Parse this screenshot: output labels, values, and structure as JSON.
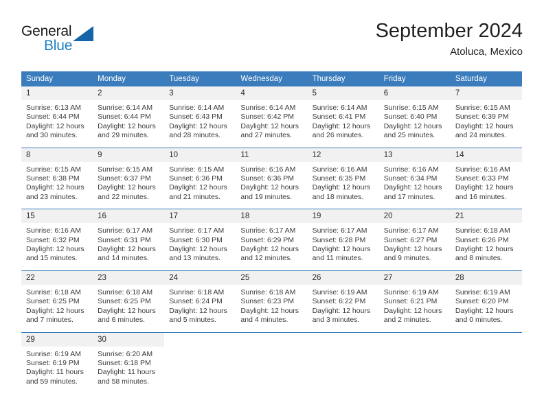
{
  "brand": {
    "name_part1": "General",
    "name_part2": "Blue",
    "logo_icon": "triangle-logo-icon",
    "accent_color": "#1c7fc4",
    "triangle_color": "#1565a8"
  },
  "header": {
    "title": "September 2024",
    "subtitle": "Atoluca, Mexico"
  },
  "theme": {
    "header_blue": "#3b7cbd",
    "daynum_bg": "#f1f1f1",
    "text": "#2b2b2b"
  },
  "calendar": {
    "weekday_headers": [
      "Sunday",
      "Monday",
      "Tuesday",
      "Wednesday",
      "Thursday",
      "Friday",
      "Saturday"
    ],
    "weeks": [
      [
        {
          "day": "1",
          "sunrise": "Sunrise: 6:13 AM",
          "sunset": "Sunset: 6:44 PM",
          "daylight_line1": "Daylight: 12 hours",
          "daylight_line2": "and 30 minutes."
        },
        {
          "day": "2",
          "sunrise": "Sunrise: 6:14 AM",
          "sunset": "Sunset: 6:44 PM",
          "daylight_line1": "Daylight: 12 hours",
          "daylight_line2": "and 29 minutes."
        },
        {
          "day": "3",
          "sunrise": "Sunrise: 6:14 AM",
          "sunset": "Sunset: 6:43 PM",
          "daylight_line1": "Daylight: 12 hours",
          "daylight_line2": "and 28 minutes."
        },
        {
          "day": "4",
          "sunrise": "Sunrise: 6:14 AM",
          "sunset": "Sunset: 6:42 PM",
          "daylight_line1": "Daylight: 12 hours",
          "daylight_line2": "and 27 minutes."
        },
        {
          "day": "5",
          "sunrise": "Sunrise: 6:14 AM",
          "sunset": "Sunset: 6:41 PM",
          "daylight_line1": "Daylight: 12 hours",
          "daylight_line2": "and 26 minutes."
        },
        {
          "day": "6",
          "sunrise": "Sunrise: 6:15 AM",
          "sunset": "Sunset: 6:40 PM",
          "daylight_line1": "Daylight: 12 hours",
          "daylight_line2": "and 25 minutes."
        },
        {
          "day": "7",
          "sunrise": "Sunrise: 6:15 AM",
          "sunset": "Sunset: 6:39 PM",
          "daylight_line1": "Daylight: 12 hours",
          "daylight_line2": "and 24 minutes."
        }
      ],
      [
        {
          "day": "8",
          "sunrise": "Sunrise: 6:15 AM",
          "sunset": "Sunset: 6:38 PM",
          "daylight_line1": "Daylight: 12 hours",
          "daylight_line2": "and 23 minutes."
        },
        {
          "day": "9",
          "sunrise": "Sunrise: 6:15 AM",
          "sunset": "Sunset: 6:37 PM",
          "daylight_line1": "Daylight: 12 hours",
          "daylight_line2": "and 22 minutes."
        },
        {
          "day": "10",
          "sunrise": "Sunrise: 6:15 AM",
          "sunset": "Sunset: 6:36 PM",
          "daylight_line1": "Daylight: 12 hours",
          "daylight_line2": "and 21 minutes."
        },
        {
          "day": "11",
          "sunrise": "Sunrise: 6:16 AM",
          "sunset": "Sunset: 6:36 PM",
          "daylight_line1": "Daylight: 12 hours",
          "daylight_line2": "and 19 minutes."
        },
        {
          "day": "12",
          "sunrise": "Sunrise: 6:16 AM",
          "sunset": "Sunset: 6:35 PM",
          "daylight_line1": "Daylight: 12 hours",
          "daylight_line2": "and 18 minutes."
        },
        {
          "day": "13",
          "sunrise": "Sunrise: 6:16 AM",
          "sunset": "Sunset: 6:34 PM",
          "daylight_line1": "Daylight: 12 hours",
          "daylight_line2": "and 17 minutes."
        },
        {
          "day": "14",
          "sunrise": "Sunrise: 6:16 AM",
          "sunset": "Sunset: 6:33 PM",
          "daylight_line1": "Daylight: 12 hours",
          "daylight_line2": "and 16 minutes."
        }
      ],
      [
        {
          "day": "15",
          "sunrise": "Sunrise: 6:16 AM",
          "sunset": "Sunset: 6:32 PM",
          "daylight_line1": "Daylight: 12 hours",
          "daylight_line2": "and 15 minutes."
        },
        {
          "day": "16",
          "sunrise": "Sunrise: 6:17 AM",
          "sunset": "Sunset: 6:31 PM",
          "daylight_line1": "Daylight: 12 hours",
          "daylight_line2": "and 14 minutes."
        },
        {
          "day": "17",
          "sunrise": "Sunrise: 6:17 AM",
          "sunset": "Sunset: 6:30 PM",
          "daylight_line1": "Daylight: 12 hours",
          "daylight_line2": "and 13 minutes."
        },
        {
          "day": "18",
          "sunrise": "Sunrise: 6:17 AM",
          "sunset": "Sunset: 6:29 PM",
          "daylight_line1": "Daylight: 12 hours",
          "daylight_line2": "and 12 minutes."
        },
        {
          "day": "19",
          "sunrise": "Sunrise: 6:17 AM",
          "sunset": "Sunset: 6:28 PM",
          "daylight_line1": "Daylight: 12 hours",
          "daylight_line2": "and 11 minutes."
        },
        {
          "day": "20",
          "sunrise": "Sunrise: 6:17 AM",
          "sunset": "Sunset: 6:27 PM",
          "daylight_line1": "Daylight: 12 hours",
          "daylight_line2": "and 9 minutes."
        },
        {
          "day": "21",
          "sunrise": "Sunrise: 6:18 AM",
          "sunset": "Sunset: 6:26 PM",
          "daylight_line1": "Daylight: 12 hours",
          "daylight_line2": "and 8 minutes."
        }
      ],
      [
        {
          "day": "22",
          "sunrise": "Sunrise: 6:18 AM",
          "sunset": "Sunset: 6:25 PM",
          "daylight_line1": "Daylight: 12 hours",
          "daylight_line2": "and 7 minutes."
        },
        {
          "day": "23",
          "sunrise": "Sunrise: 6:18 AM",
          "sunset": "Sunset: 6:25 PM",
          "daylight_line1": "Daylight: 12 hours",
          "daylight_line2": "and 6 minutes."
        },
        {
          "day": "24",
          "sunrise": "Sunrise: 6:18 AM",
          "sunset": "Sunset: 6:24 PM",
          "daylight_line1": "Daylight: 12 hours",
          "daylight_line2": "and 5 minutes."
        },
        {
          "day": "25",
          "sunrise": "Sunrise: 6:18 AM",
          "sunset": "Sunset: 6:23 PM",
          "daylight_line1": "Daylight: 12 hours",
          "daylight_line2": "and 4 minutes."
        },
        {
          "day": "26",
          "sunrise": "Sunrise: 6:19 AM",
          "sunset": "Sunset: 6:22 PM",
          "daylight_line1": "Daylight: 12 hours",
          "daylight_line2": "and 3 minutes."
        },
        {
          "day": "27",
          "sunrise": "Sunrise: 6:19 AM",
          "sunset": "Sunset: 6:21 PM",
          "daylight_line1": "Daylight: 12 hours",
          "daylight_line2": "and 2 minutes."
        },
        {
          "day": "28",
          "sunrise": "Sunrise: 6:19 AM",
          "sunset": "Sunset: 6:20 PM",
          "daylight_line1": "Daylight: 12 hours",
          "daylight_line2": "and 0 minutes."
        }
      ],
      [
        {
          "day": "29",
          "sunrise": "Sunrise: 6:19 AM",
          "sunset": "Sunset: 6:19 PM",
          "daylight_line1": "Daylight: 11 hours",
          "daylight_line2": "and 59 minutes."
        },
        {
          "day": "30",
          "sunrise": "Sunrise: 6:20 AM",
          "sunset": "Sunset: 6:18 PM",
          "daylight_line1": "Daylight: 11 hours",
          "daylight_line2": "and 58 minutes."
        },
        {
          "day": "",
          "sunrise": "",
          "sunset": "",
          "daylight_line1": "",
          "daylight_line2": ""
        },
        {
          "day": "",
          "sunrise": "",
          "sunset": "",
          "daylight_line1": "",
          "daylight_line2": ""
        },
        {
          "day": "",
          "sunrise": "",
          "sunset": "",
          "daylight_line1": "",
          "daylight_line2": ""
        },
        {
          "day": "",
          "sunrise": "",
          "sunset": "",
          "daylight_line1": "",
          "daylight_line2": ""
        },
        {
          "day": "",
          "sunrise": "",
          "sunset": "",
          "daylight_line1": "",
          "daylight_line2": ""
        }
      ]
    ]
  }
}
